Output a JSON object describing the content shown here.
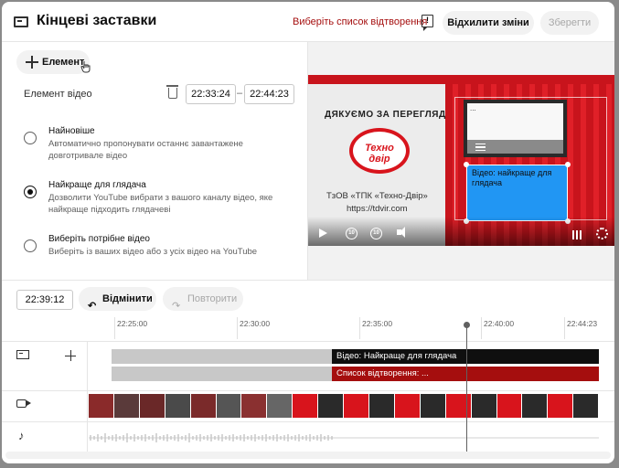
{
  "header": {
    "title": "Кінцеві заставки",
    "playlist_link": "Виберіть список відтворення",
    "feedback_glyph": "!",
    "discard_label": "Відхилити зміни",
    "save_label": "Зберегти"
  },
  "editor": {
    "add_element_label": "Елемент",
    "element_label": "Елемент відео",
    "start_time": "22:33:24",
    "dash": "–",
    "end_time": "22:44:23",
    "options": [
      {
        "title": "Найновіше",
        "desc": "Автоматично пропонувати останнє завантажене довготривале відео",
        "selected": false
      },
      {
        "title": "Найкраще для глядача",
        "desc": "Дозволити YouTube вибрати з вашого каналу відео, яке найкраще підходить глядачеві",
        "selected": true
      },
      {
        "title": "Виберіть потрібне відео",
        "desc": "Виберіть із ваших відео або з усіх відео на YouTube",
        "selected": false
      }
    ]
  },
  "preview": {
    "thanks_text": "ДЯКУЄМО ЗА ПЕРЕГЛЯД",
    "logo_text": "Техно двір",
    "company_text": "ТзОВ «ТПК «Техно-Двір»",
    "site_text": "https://tdvir.com",
    "video_element_dots": "...",
    "best_element_text": "Відео: найкраще для глядача",
    "rewind_text": "10",
    "forward_text": "10"
  },
  "edit_bar": {
    "current_time": "22:39:12",
    "undo_label": "Відмінити",
    "redo_label": "Повторити"
  },
  "timeline": {
    "ruler": [
      "22:25:00",
      "22:30:00",
      "22:35:00",
      "22:40:00",
      "22:44:23"
    ],
    "video_bar_label": "Відео: Найкраще для глядача",
    "playlist_bar_label": "Список відтворення: ..."
  },
  "colors": {
    "accent_red": "#a50e0e",
    "brand_red": "#d8141c",
    "element_blue": "#2196f3"
  }
}
